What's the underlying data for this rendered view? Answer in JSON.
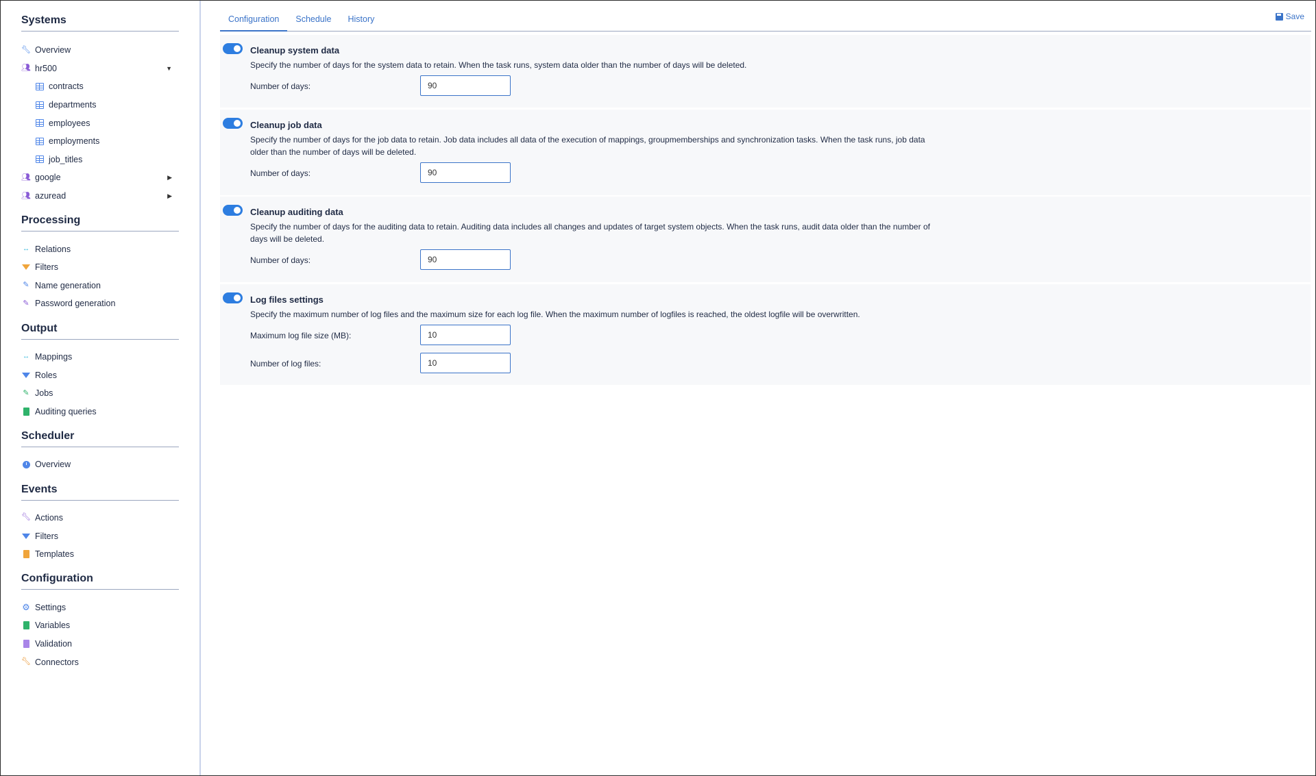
{
  "sidebar": {
    "systems": {
      "title": "Systems",
      "items": [
        {
          "label": "Overview"
        },
        {
          "label": "hr500"
        },
        {
          "label": "contracts"
        },
        {
          "label": "departments"
        },
        {
          "label": "employees"
        },
        {
          "label": "employments"
        },
        {
          "label": "job_titles"
        },
        {
          "label": "google"
        },
        {
          "label": "azuread"
        }
      ]
    },
    "processing": {
      "title": "Processing",
      "items": [
        {
          "label": "Relations"
        },
        {
          "label": "Filters"
        },
        {
          "label": "Name generation"
        },
        {
          "label": "Password generation"
        }
      ]
    },
    "output": {
      "title": "Output",
      "items": [
        {
          "label": "Mappings"
        },
        {
          "label": "Roles"
        },
        {
          "label": "Jobs"
        },
        {
          "label": "Auditing queries"
        }
      ]
    },
    "scheduler": {
      "title": "Scheduler",
      "items": [
        {
          "label": "Overview"
        }
      ]
    },
    "events": {
      "title": "Events",
      "items": [
        {
          "label": "Actions"
        },
        {
          "label": "Filters"
        },
        {
          "label": "Templates"
        }
      ]
    },
    "configuration": {
      "title": "Configuration",
      "items": [
        {
          "label": "Settings"
        },
        {
          "label": "Variables"
        },
        {
          "label": "Validation"
        },
        {
          "label": "Connectors"
        }
      ]
    }
  },
  "tabs": [
    {
      "label": "Configuration",
      "active": true
    },
    {
      "label": "Schedule",
      "active": false
    },
    {
      "label": "History",
      "active": false
    }
  ],
  "save_label": "Save",
  "cards": {
    "system": {
      "enabled": true,
      "title": "Cleanup system data",
      "description": "Specify the number of days for the system data to retain. When the task runs, system data older than the number of days will be deleted.",
      "days_label": "Number of days:",
      "days_value": "90"
    },
    "job": {
      "enabled": true,
      "title": "Cleanup job data",
      "description": "Specify the number of days for the job data to retain. Job data includes all data of the execution of mappings, groupmemberships and synchronization tasks. When the task runs, job data older than the number of days will be deleted.",
      "days_label": "Number of days:",
      "days_value": "90"
    },
    "auditing": {
      "enabled": true,
      "title": "Cleanup auditing data",
      "description": "Specify the number of days for the auditing data to retain. Auditing data includes all changes and updates of target system objects. When the task runs, audit data older than the number of days will be deleted.",
      "days_label": "Number of days:",
      "days_value": "90"
    },
    "logs": {
      "enabled": true,
      "title": "Log files settings",
      "description": "Specify the maximum number of log files and the maximum size for each log file. When the maximum number of logfiles is reached, the oldest logfile will be overwritten.",
      "size_label": "Maximum log file size (MB):",
      "size_value": "10",
      "count_label": "Number of log files:",
      "count_value": "10"
    }
  },
  "colors": {
    "accent": "#2d7de0",
    "link": "#3a73c8",
    "card_bg": "#f7f8fa"
  }
}
